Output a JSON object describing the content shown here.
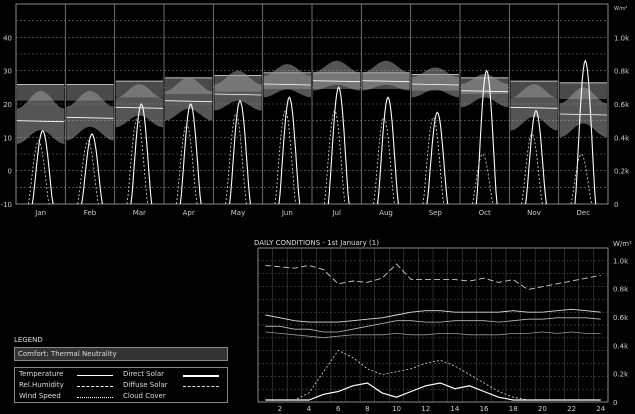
{
  "chart_data": [
    {
      "type": "line",
      "panel": "monthly",
      "months": [
        "Jan",
        "Feb",
        "Mar",
        "Apr",
        "May",
        "Jun",
        "Jul",
        "Aug",
        "Sep",
        "Oct",
        "Nov",
        "Dec"
      ],
      "y_left_ticks": [
        "40",
        "30",
        "20",
        "10",
        "0",
        "-10"
      ],
      "y_right_ticks": [
        "1.0k",
        "0.8k",
        "0.6k",
        "0.4k",
        "0.2k",
        "0"
      ],
      "y_right_unit": "W/m²",
      "ylim": [
        -10,
        50
      ],
      "grid": true,
      "series": [
        {
          "name": "Comfort: Thermal Neutrality",
          "values": [
            23.5,
            23.5,
            24.5,
            25.5,
            26.2,
            27.0,
            27.0,
            27.0,
            26.5,
            25.5,
            24.5,
            24.0
          ]
        },
        {
          "name": "Temperature",
          "mean": [
            15,
            16,
            19,
            21,
            23,
            26,
            27,
            27,
            26,
            24,
            19,
            17
          ],
          "min": [
            8,
            9,
            13,
            15,
            18,
            22,
            24,
            24,
            22,
            19,
            12,
            10
          ],
          "max": [
            24,
            24,
            26,
            28,
            30,
            32,
            33,
            33,
            31,
            29,
            26,
            25
          ]
        },
        {
          "name": "Direct Solar",
          "peak": [
            440,
            420,
            600,
            600,
            620,
            640,
            700,
            640,
            550,
            800,
            560,
            860
          ]
        },
        {
          "name": "Diffuse Solar",
          "peak": [
            380,
            380,
            520,
            480,
            540,
            560,
            560,
            520,
            520,
            300,
            420,
            300
          ]
        }
      ]
    },
    {
      "type": "line",
      "panel": "daily",
      "title": "DAILY CONDITIONS - 1st January (1)",
      "x_ticks": [
        "2",
        "4",
        "6",
        "8",
        "10",
        "12",
        "14",
        "16",
        "18",
        "20",
        "22",
        "24"
      ],
      "y_right_ticks": [
        "1.0k",
        "0.8k",
        "0.6k",
        "0.4k",
        "0.2k",
        "0"
      ],
      "y_right_unit": "W/m²",
      "series": [
        {
          "name": "Cloud Cover",
          "values": [
            0.95,
            0.94,
            0.93,
            0.95,
            0.92,
            0.82,
            0.84,
            0.83,
            0.86,
            0.96,
            0.85,
            0.85,
            0.85,
            0.85,
            0.84,
            0.86,
            0.83,
            0.85,
            0.78,
            0.8,
            0.82,
            0.84,
            0.86,
            0.88
          ]
        },
        {
          "name": "Temperature",
          "values": [
            0.6,
            0.58,
            0.56,
            0.55,
            0.55,
            0.55,
            0.56,
            0.57,
            0.58,
            0.6,
            0.62,
            0.63,
            0.63,
            0.62,
            0.62,
            0.62,
            0.62,
            0.63,
            0.62,
            0.62,
            0.63,
            0.64,
            0.63,
            0.62
          ]
        },
        {
          "name": "Rel.Humidity",
          "values": [
            0.52,
            0.52,
            0.5,
            0.5,
            0.48,
            0.48,
            0.5,
            0.52,
            0.54,
            0.56,
            0.56,
            0.55,
            0.55,
            0.56,
            0.56,
            0.56,
            0.55,
            0.56,
            0.57,
            0.57,
            0.58,
            0.58,
            0.58,
            0.57
          ]
        },
        {
          "name": "Wind Speed",
          "values": [
            0.48,
            0.47,
            0.46,
            0.45,
            0.44,
            0.45,
            0.46,
            0.46,
            0.46,
            0.47,
            0.46,
            0.46,
            0.47,
            0.47,
            0.46,
            0.46,
            0.46,
            0.47,
            0.47,
            0.48,
            0.47,
            0.48,
            0.47,
            0.47
          ]
        },
        {
          "name": "Diffuse Solar",
          "values": [
            0.0,
            0.0,
            0.0,
            0.05,
            0.2,
            0.35,
            0.3,
            0.22,
            0.18,
            0.2,
            0.22,
            0.26,
            0.28,
            0.24,
            0.18,
            0.12,
            0.06,
            0.02,
            0.0,
            0.0,
            0.0,
            0.0,
            0.0,
            0.0
          ]
        },
        {
          "name": "Direct Solar",
          "values": [
            0.0,
            0.0,
            0.0,
            0.0,
            0.04,
            0.06,
            0.1,
            0.12,
            0.05,
            0.02,
            0.06,
            0.1,
            0.12,
            0.08,
            0.1,
            0.06,
            0.02,
            0.0,
            0.0,
            0.0,
            0.0,
            0.0,
            0.0,
            0.0
          ]
        }
      ]
    }
  ],
  "legend": {
    "title": "LEGEND",
    "bar": "Comfort: Thermal Neutrality",
    "items": {
      "temperature": "Temperature",
      "rel_humidity": "Rel.Humidity",
      "wind_speed": "Wind Speed",
      "direct_solar": "Direct Solar",
      "diffuse_solar": "Diffuse Solar",
      "cloud_cover": "Cloud Cover"
    }
  }
}
